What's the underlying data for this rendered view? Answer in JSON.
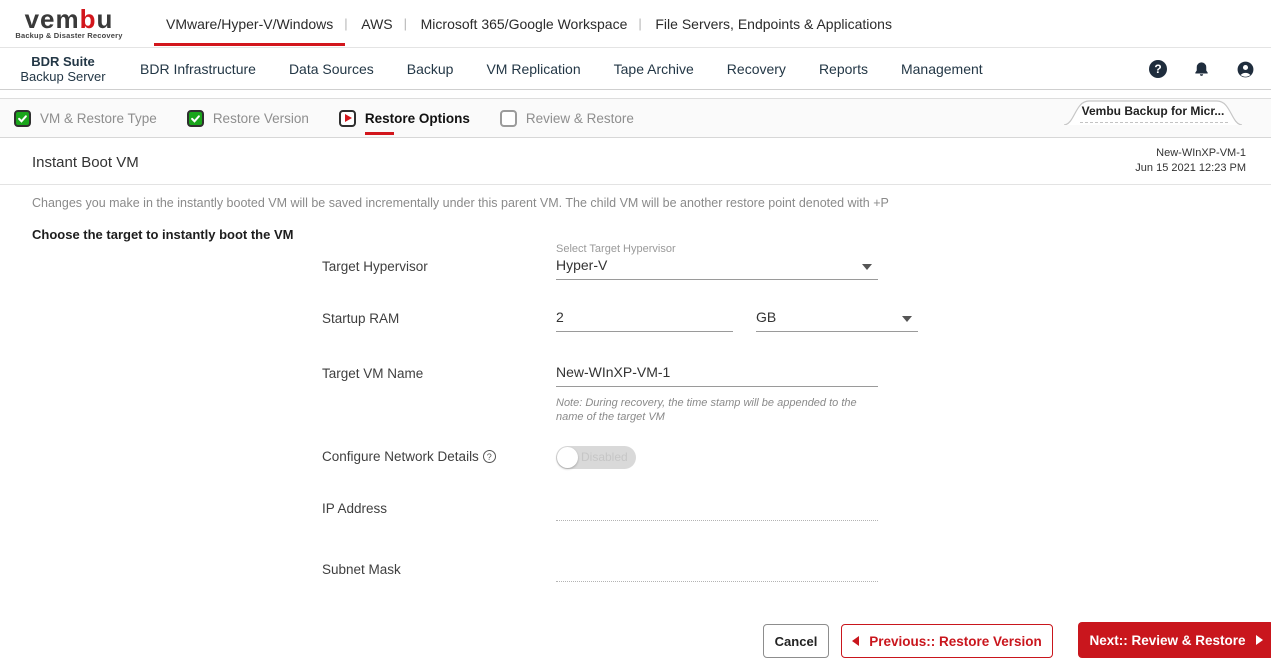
{
  "brand": {
    "logo_prefix": "vem",
    "logo_accent": "b",
    "logo_suffix": "u",
    "tagline": "Backup & Disaster Recovery"
  },
  "colors": {
    "brand_red": "#d2161c",
    "button_red": "#c9161d",
    "step_green": "#1aa51b",
    "icon_dark": "#1f2d3d",
    "muted_text": "#8a8a8a"
  },
  "top_nav": {
    "items": [
      {
        "label": "VMware/Hyper-V/Windows",
        "active": true
      },
      {
        "label": "AWS",
        "active": false
      },
      {
        "label": "Microsoft 365/Google Workspace",
        "active": false
      },
      {
        "label": "File Servers, Endpoints & Applications",
        "active": false
      }
    ]
  },
  "product_nav": {
    "suite_title": "BDR Suite",
    "suite_subtitle": "Backup Server",
    "items": [
      {
        "label": "BDR Infrastructure"
      },
      {
        "label": "Data Sources"
      },
      {
        "label": "Backup"
      },
      {
        "label": "VM Replication"
      },
      {
        "label": "Tape Archive"
      },
      {
        "label": "Recovery"
      },
      {
        "label": "Reports"
      },
      {
        "label": "Management"
      }
    ],
    "help_icon_glyph": "?"
  },
  "wizard": {
    "steps": [
      {
        "label": "VM & Restore Type",
        "state": "completed"
      },
      {
        "label": "Restore Version",
        "state": "completed"
      },
      {
        "label": "Restore Options",
        "state": "active"
      },
      {
        "label": "Review & Restore",
        "state": "pending"
      }
    ],
    "corner_tab_label": "Vembu Backup for Micr..."
  },
  "page_header": {
    "title": "Instant Boot VM",
    "vm_name": "New-WInXP-VM-1",
    "timestamp": "Jun 15 2021 12:23 PM"
  },
  "content": {
    "description": "Changes you make in the instantly booted VM will be saved incrementally under this parent VM. The child VM will be another restore point denoted with +P",
    "section_heading": "Choose the target to instantly boot the VM"
  },
  "form": {
    "target_hypervisor": {
      "label": "Target Hypervisor",
      "floating_label": "Select Target Hypervisor",
      "value": "Hyper-V"
    },
    "startup_ram": {
      "label": "Startup RAM",
      "value": "2",
      "unit": "GB"
    },
    "target_vm_name": {
      "label": "Target VM Name",
      "value": "New-WInXP-VM-1",
      "note": "Note: During recovery, the time stamp will be appended to the name of the target VM"
    },
    "configure_network": {
      "label": "Configure Network Details",
      "help_glyph": "?",
      "toggle_state": "Disabled"
    },
    "ip_address": {
      "label": "IP Address",
      "value": ""
    },
    "subnet_mask": {
      "label": "Subnet Mask",
      "value": ""
    }
  },
  "footer": {
    "cancel_label": "Cancel",
    "previous_label": "Previous:: Restore Version",
    "next_label": "Next:: Review & Restore"
  }
}
